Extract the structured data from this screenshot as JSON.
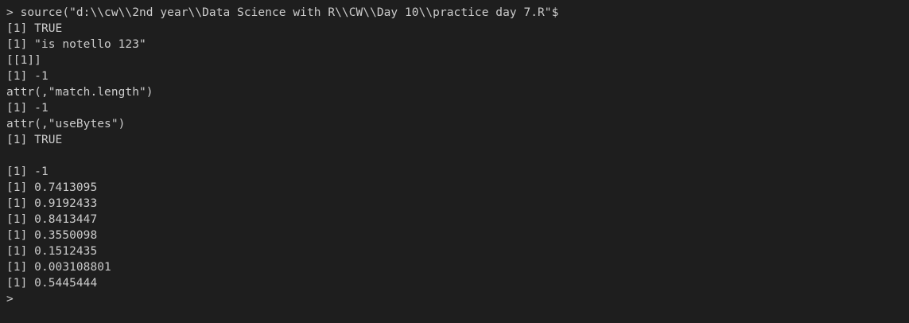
{
  "console": {
    "lines": [
      "> source(\"d:\\\\cw\\\\2nd year\\\\Data Science with R\\\\CW\\\\Day 10\\\\practice day 7.R\"$",
      "[1] TRUE",
      "[1] \"is notello 123\"",
      "[[1]]",
      "[1] -1",
      "attr(,\"match.length\")",
      "[1] -1",
      "attr(,\"useBytes\")",
      "[1] TRUE",
      "",
      "[1] -1",
      "[1] 0.7413095",
      "[1] 0.9192433",
      "[1] 0.8413447",
      "[1] 0.3550098",
      "[1] 0.1512435",
      "[1] 0.003108801",
      "[1] 0.5445444",
      ">"
    ]
  }
}
